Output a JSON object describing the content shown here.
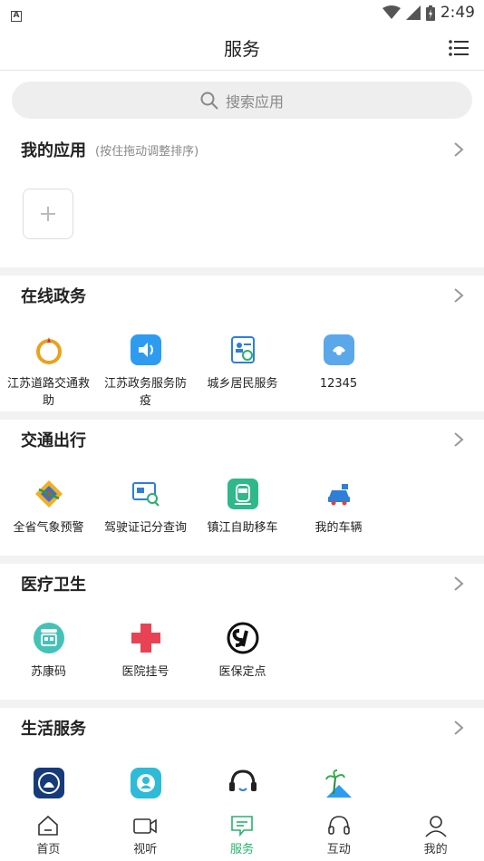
{
  "status": {
    "time": "2:49"
  },
  "header": {
    "title": "服务"
  },
  "search": {
    "placeholder": "搜索应用"
  },
  "my_apps": {
    "title": "我的应用",
    "hint": "(按住拖动调整排序)"
  },
  "sections": [
    {
      "title": "在线政务",
      "items": [
        {
          "label": "江苏道路交通救助",
          "icon": "emblem-icon"
        },
        {
          "label": "江苏政务服务防疫",
          "icon": "speaker-icon"
        },
        {
          "label": "城乡居民服务",
          "icon": "resident-card-icon"
        },
        {
          "label": "12345",
          "icon": "hotline-icon"
        }
      ]
    },
    {
      "title": "交通出行",
      "items": [
        {
          "label": "全省气象预警",
          "icon": "weather-logo-icon"
        },
        {
          "label": "驾驶证记分查询",
          "icon": "license-search-icon"
        },
        {
          "label": "镇江自助移车",
          "icon": "car-move-icon"
        },
        {
          "label": "我的车辆",
          "icon": "my-car-icon"
        }
      ]
    },
    {
      "title": "医疗卫生",
      "items": [
        {
          "label": "苏康码",
          "icon": "health-code-icon"
        },
        {
          "label": "医院挂号",
          "icon": "red-cross-icon"
        },
        {
          "label": "医保定点",
          "icon": "si-logo-icon"
        }
      ]
    },
    {
      "title": "生活服务",
      "items": [
        {
          "label": "",
          "icon": "police-badge-icon"
        },
        {
          "label": "",
          "icon": "person-bubble-icon"
        },
        {
          "label": "",
          "icon": "headset-icon"
        },
        {
          "label": "",
          "icon": "beach-icon"
        }
      ]
    }
  ],
  "nav": [
    {
      "label": "首页",
      "icon": "home-icon"
    },
    {
      "label": "视听",
      "icon": "video-icon"
    },
    {
      "label": "服务",
      "icon": "service-icon",
      "active": true
    },
    {
      "label": "互动",
      "icon": "headphones-icon"
    },
    {
      "label": "我的",
      "icon": "profile-icon"
    }
  ],
  "colors": {
    "accent": "#26b36b",
    "divider": "#f2f2f2"
  }
}
